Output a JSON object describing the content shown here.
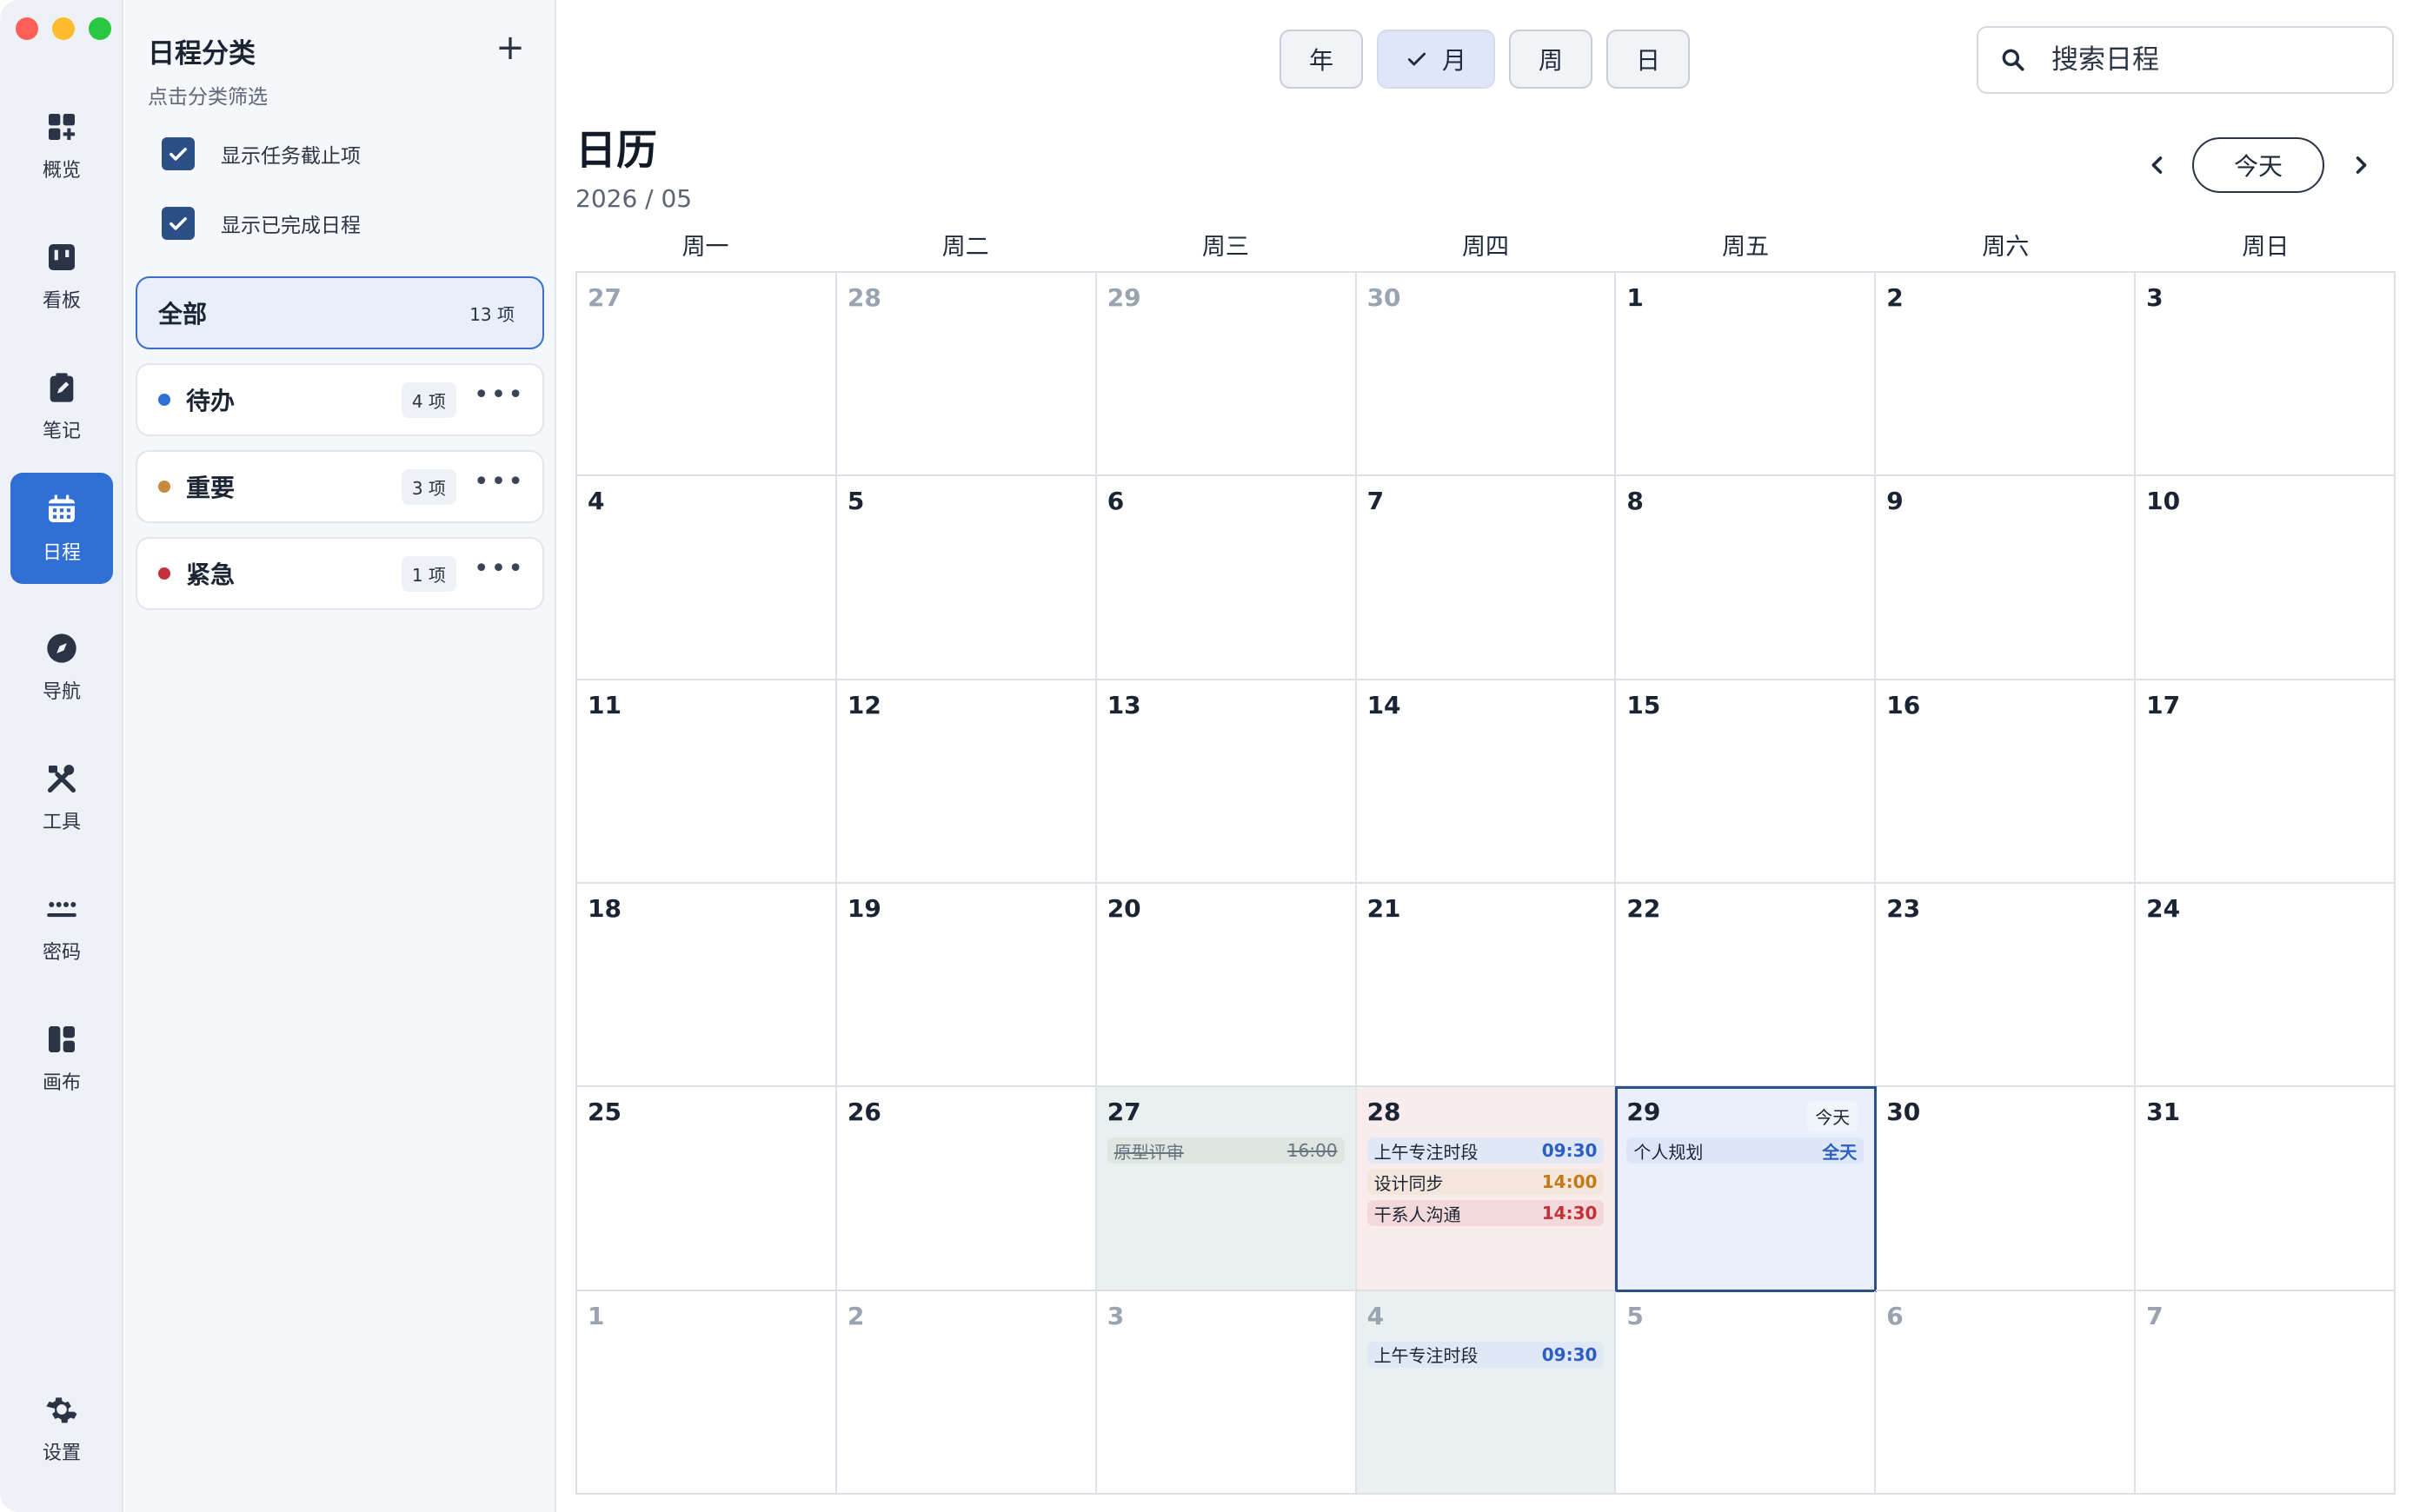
{
  "nav": [
    {
      "label": "概览",
      "icon": "dashboard-icon"
    },
    {
      "label": "看板",
      "icon": "kanban-icon"
    },
    {
      "label": "笔记",
      "icon": "note-icon"
    },
    {
      "label": "日程",
      "icon": "calendar-icon",
      "active": true
    },
    {
      "label": "导航",
      "icon": "compass-icon"
    },
    {
      "label": "工具",
      "icon": "tools-icon"
    },
    {
      "label": "密码",
      "icon": "password-icon"
    },
    {
      "label": "画布",
      "icon": "canvas-icon"
    }
  ],
  "settings": {
    "label": "设置",
    "icon": "gear-icon"
  },
  "category_panel": {
    "title": "日程分类",
    "subtitle": "点击分类筛选",
    "add": "+",
    "options": [
      {
        "label": "显示任务截止项",
        "checked": true
      },
      {
        "label": "显示已完成日程",
        "checked": true
      }
    ],
    "categories": [
      {
        "name": "全部",
        "count": "13 项",
        "active": true,
        "color": ""
      },
      {
        "name": "待办",
        "count": "4 项",
        "color": "#2f6fd6"
      },
      {
        "name": "重要",
        "count": "3 项",
        "color": "#c9893a"
      },
      {
        "name": "紧急",
        "count": "1 项",
        "color": "#c2323a"
      }
    ]
  },
  "view_switch": [
    {
      "label": "年",
      "active": false
    },
    {
      "label": "月",
      "active": true
    },
    {
      "label": "周",
      "active": false
    },
    {
      "label": "日",
      "active": false
    }
  ],
  "search": {
    "placeholder": "搜索日程"
  },
  "calendar": {
    "title": "日历",
    "subtitle": "2026 / 05",
    "today_button": "今天",
    "weekdays": [
      "周一",
      "周二",
      "周三",
      "周四",
      "周五",
      "周六",
      "周日"
    ],
    "weeks": [
      [
        {
          "d": "27",
          "m": true
        },
        {
          "d": "28",
          "m": true
        },
        {
          "d": "29",
          "m": true
        },
        {
          "d": "30",
          "m": true
        },
        {
          "d": "1"
        },
        {
          "d": "2"
        },
        {
          "d": "3"
        }
      ],
      [
        {
          "d": "4"
        },
        {
          "d": "5"
        },
        {
          "d": "6"
        },
        {
          "d": "7"
        },
        {
          "d": "8"
        },
        {
          "d": "9"
        },
        {
          "d": "10"
        }
      ],
      [
        {
          "d": "11"
        },
        {
          "d": "12"
        },
        {
          "d": "13"
        },
        {
          "d": "14"
        },
        {
          "d": "15"
        },
        {
          "d": "16"
        },
        {
          "d": "17"
        }
      ],
      [
        {
          "d": "18"
        },
        {
          "d": "19"
        },
        {
          "d": "20"
        },
        {
          "d": "21"
        },
        {
          "d": "22"
        },
        {
          "d": "23"
        },
        {
          "d": "24"
        }
      ],
      [
        {
          "d": "25"
        },
        {
          "d": "26"
        },
        {
          "d": "27",
          "tint": "green",
          "events": [
            {
              "title": "原型评审",
              "time": "16:00",
              "style": "done"
            }
          ]
        },
        {
          "d": "28",
          "tint": "pink",
          "events": [
            {
              "title": "上午专注时段",
              "time": "09:30",
              "style": "blue"
            },
            {
              "title": "设计同步",
              "time": "14:00",
              "style": "orange"
            },
            {
              "title": "干系人沟通",
              "time": "14:30",
              "style": "red"
            }
          ]
        },
        {
          "d": "29",
          "tint": "blue",
          "today": "今天",
          "events": [
            {
              "title": "个人规划",
              "time": "全天",
              "style": "allday"
            }
          ]
        },
        {
          "d": "30"
        },
        {
          "d": "31"
        }
      ],
      [
        {
          "d": "1",
          "m": true
        },
        {
          "d": "2",
          "m": true
        },
        {
          "d": "3",
          "m": true
        },
        {
          "d": "4",
          "m": true,
          "tint": "green",
          "events": [
            {
              "title": "上午专注时段",
              "time": "09:30",
              "style": "blue"
            }
          ]
        },
        {
          "d": "5",
          "m": true
        },
        {
          "d": "6",
          "m": true
        },
        {
          "d": "7",
          "m": true
        }
      ]
    ]
  }
}
